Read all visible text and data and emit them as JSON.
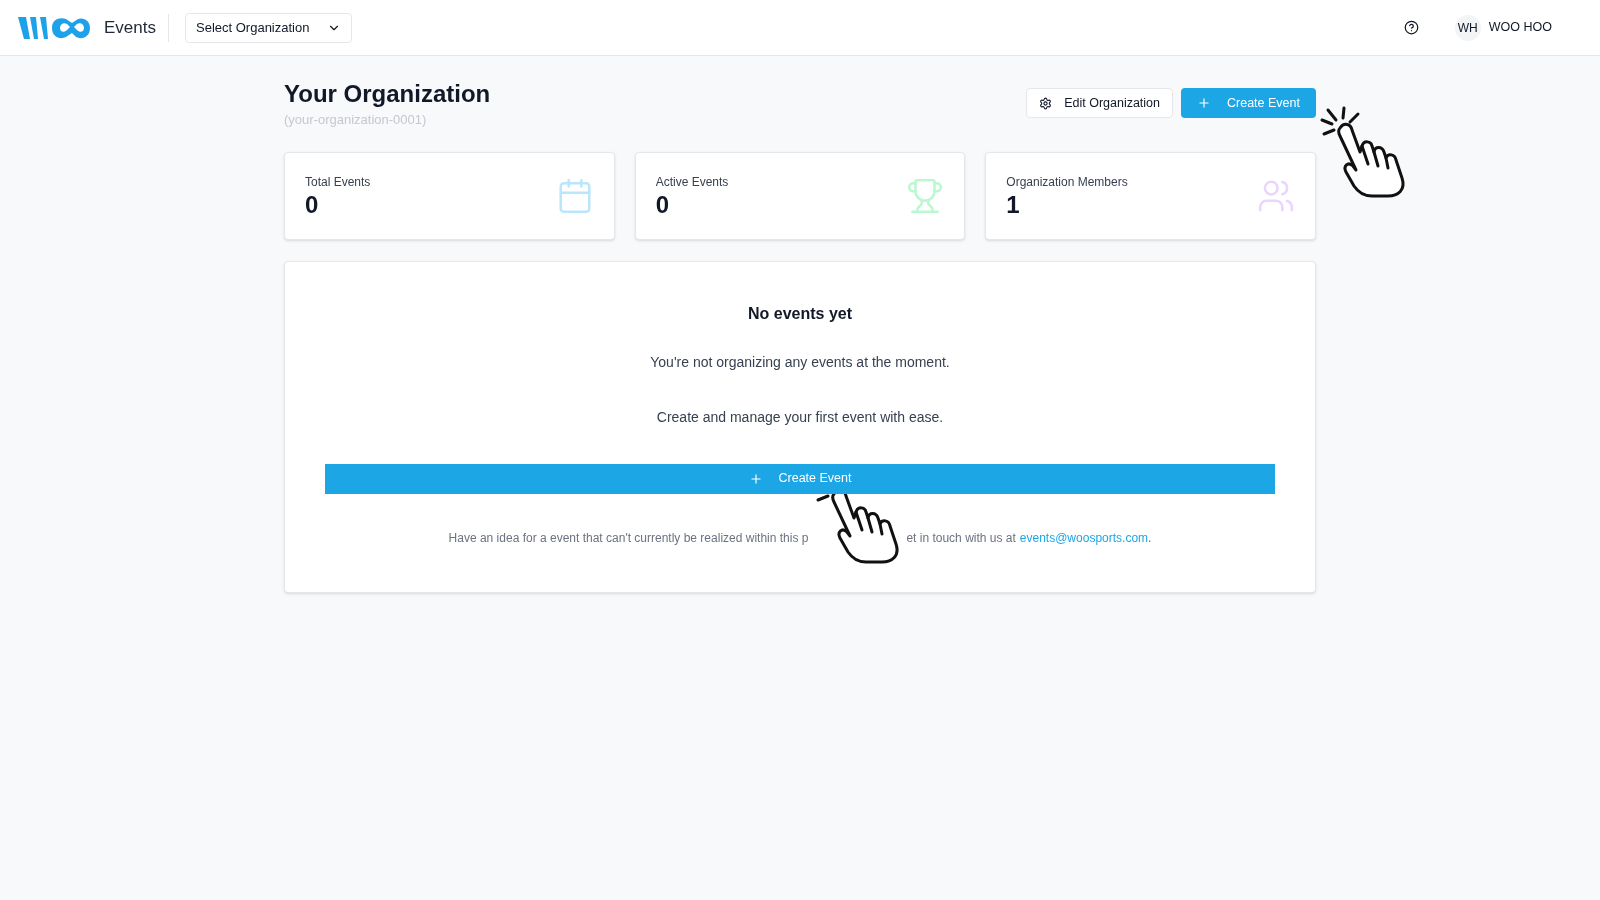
{
  "header": {
    "app_name": "Events",
    "org_select": {
      "value": "Select Organization"
    },
    "user": {
      "initials": "WH",
      "name": "WOO HOO"
    }
  },
  "page": {
    "title": "Your Organization",
    "slug": "(your-organization-0001)",
    "actions": [
      {
        "kind": "secondary",
        "label": "Edit Organization"
      },
      {
        "kind": "primary",
        "label": "Create Event"
      }
    ]
  },
  "stats": [
    {
      "label": "Total Events",
      "value": "0",
      "kind": "calendar",
      "color": "#bae6fd"
    },
    {
      "label": "Active Events",
      "value": "0",
      "kind": "trophy",
      "color": "#bbf7d0"
    },
    {
      "label": "Organization Members",
      "value": "1",
      "kind": "users",
      "color": "#e9d5ff"
    }
  ],
  "empty_state": {
    "heading": "No events yet",
    "lines": [
      "You're not organizing any events at the moment.",
      "Create and manage your first event with ease."
    ],
    "button": "Create Event",
    "footer_parts": [
      "Have an idea for a event that can't currently be realized within this p",
      "et in touch with us at"
    ],
    "email": "events@woosports.com",
    "footer_end": "."
  }
}
